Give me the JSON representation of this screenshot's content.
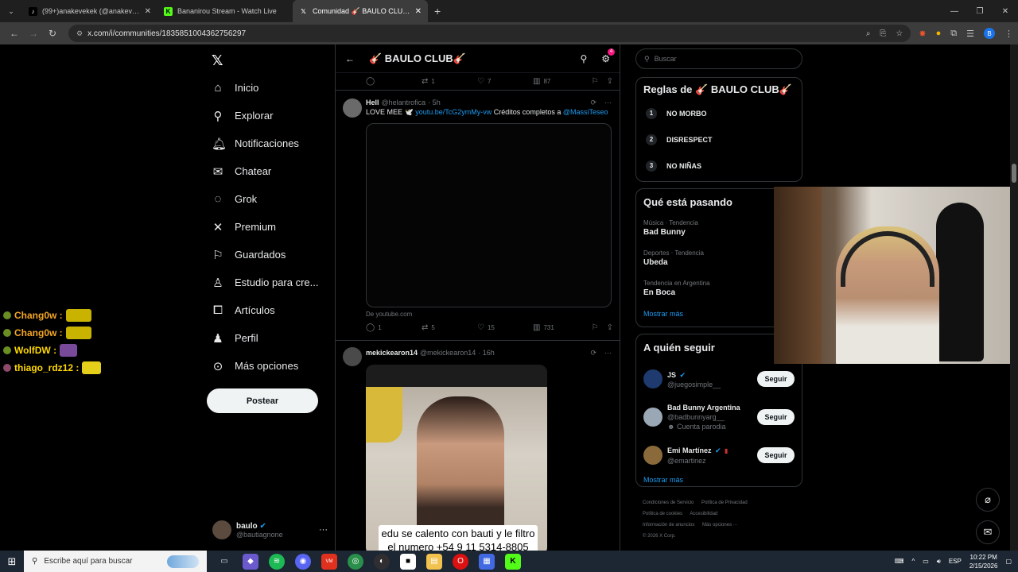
{
  "browser": {
    "tabs": [
      {
        "title": "(99+)anakevekek (@anakevepo",
        "favicon": "tiktok-icon",
        "active": false
      },
      {
        "title": "Bananirou Stream - Watch Live",
        "favicon": "kick-icon",
        "active": false
      },
      {
        "title": "Comunidad 🎸 BAULO CLUB🎸",
        "favicon": "x-icon",
        "active": true
      }
    ],
    "url": "x.com/i/communities/1835851004362756297"
  },
  "sidebar": {
    "items": [
      {
        "icon": "home-icon",
        "label": "Inicio"
      },
      {
        "icon": "search-icon",
        "label": "Explorar"
      },
      {
        "icon": "bell-icon",
        "label": "Notificaciones"
      },
      {
        "icon": "mail-icon",
        "label": "Chatear"
      },
      {
        "icon": "grok-icon",
        "label": "Grok"
      },
      {
        "icon": "x-icon",
        "label": "Premium"
      },
      {
        "icon": "bookmark-icon",
        "label": "Guardados"
      },
      {
        "icon": "studio-icon",
        "label": "Estudio para cre..."
      },
      {
        "icon": "article-icon",
        "label": "Artículos"
      },
      {
        "icon": "person-icon",
        "label": "Perfil"
      },
      {
        "icon": "more-circle-icon",
        "label": "Más opciones"
      }
    ],
    "post_label": "Postear",
    "account": {
      "name": "baulo",
      "handle": "@bautiagnone"
    }
  },
  "chat": [
    {
      "user": "Chang0w :",
      "color": "#f5a623"
    },
    {
      "user": "Chang0w :",
      "color": "#f5a623"
    },
    {
      "user": "WolfDW :",
      "color": "#ffd700"
    },
    {
      "user": "thiago_rdz12 :",
      "color": "#ffd700"
    }
  ],
  "header": {
    "title": "🎸 BAULO CLUB🎸",
    "notif_count": "4"
  },
  "prev_actions": {
    "replies": "",
    "reposts": "1",
    "likes": "7",
    "views": "87"
  },
  "tweet1": {
    "name": "Hell",
    "handle": "@helantrofica",
    "time": "· 5h",
    "text_a": "LOVE MEE 🕊️",
    "link": "youtu.be/TcG2ymMy-vw",
    "text_b": "Créditos completos a",
    "mention": "@MassiTeseo",
    "source": "De youtube.com",
    "replies": "1",
    "reposts": "5",
    "likes": "15",
    "views": "731"
  },
  "tweet2": {
    "name": "mekickearon14",
    "handle": "@mekickearon14",
    "time": "· 16h",
    "caption": "edu se calento con bauti y le filtro el numero +54 9 11 5314-8805"
  },
  "right": {
    "search_placeholder": "Buscar",
    "rules_title": "Reglas de 🎸 BAULO CLUB🎸",
    "rules": [
      {
        "num": "1",
        "text": "NO MORBO"
      },
      {
        "num": "2",
        "text": "DISRESPECT"
      },
      {
        "num": "3",
        "text": "NO NIÑAS"
      }
    ],
    "trends_title": "Qué está pasando",
    "trends": [
      {
        "meta": "Música · Tendencia",
        "topic": "Bad Bunny"
      },
      {
        "meta": "Deportes · Tendencia",
        "topic": "Ubeda"
      },
      {
        "meta": "Tendencia en Argentina",
        "topic": "En Boca"
      }
    ],
    "show_more": "Mostrar más",
    "follow_title": "A quién seguir",
    "follow": [
      {
        "name": "JS",
        "handle": "@juegosimple__",
        "extra": ""
      },
      {
        "name": "Bad Bunny Argentina",
        "handle": "@badbunnyarg__",
        "extra": "Cuenta parodia"
      },
      {
        "name": "Emi Martínez",
        "handle": "@emartinez",
        "extra": ""
      }
    ],
    "follow_btn": "Seguir",
    "footer": [
      "Condiciones de Servicio",
      "Política de Privacidad",
      "Política de cookies",
      "Accesibilidad",
      "Información de anuncios",
      "Más opciones ···",
      "© 2026 X Corp."
    ]
  },
  "taskbar": {
    "search_placeholder": "Escribe aquí para buscar",
    "lang": "ESP",
    "time": "10:22 PM",
    "date": "2/15/2026"
  }
}
